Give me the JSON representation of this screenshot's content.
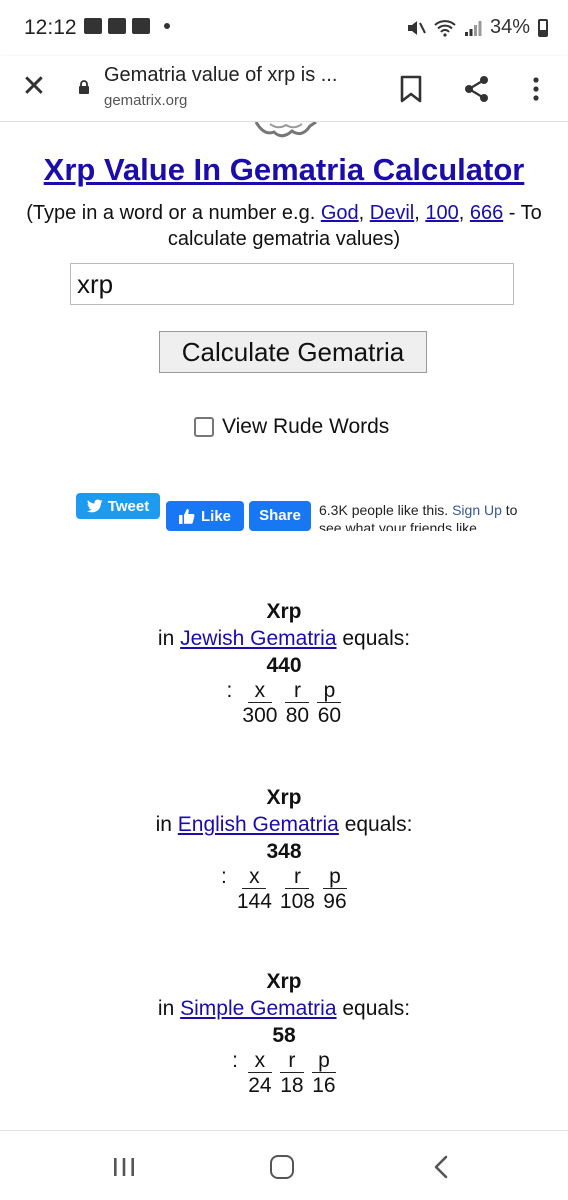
{
  "status": {
    "time": "12:12",
    "battery": "34%"
  },
  "browser": {
    "title": "Gematria value of xrp is ...",
    "domain": "gematrix.org"
  },
  "page": {
    "title": "Xrp Value In Gematria Calculator",
    "subtitle_prefix": "(Type in a word or a number e.g.",
    "examples": [
      "God",
      "Devil",
      "100",
      "666"
    ],
    "subtitle_suffix": "- To calculate gematria values)",
    "search_value": "xrp",
    "calculate_label": "Calculate Gematria",
    "rude_label": "View Rude Words",
    "tweet_label": "Tweet",
    "like_label": "Like",
    "share_label": "Share",
    "like_count_text": "6.3K people like this.",
    "sign_up_text": "Sign Up",
    "like_suffix": "to see what your friends like."
  },
  "results": [
    {
      "word": "Xrp",
      "prefix": "in",
      "system": "Jewish Gematria",
      "suffix": "equals:",
      "total": "440",
      "letters": [
        "x",
        "r",
        "p"
      ],
      "values": [
        "300",
        "80",
        "60"
      ]
    },
    {
      "word": "Xrp",
      "prefix": "in",
      "system": "English Gematria",
      "suffix": "equals:",
      "total": "348",
      "letters": [
        "x",
        "r",
        "p"
      ],
      "values": [
        "144",
        "108",
        "96"
      ]
    },
    {
      "word": "Xrp",
      "prefix": "in",
      "system": "Simple Gematria",
      "suffix": "equals:",
      "total": "58",
      "letters": [
        "x",
        "r",
        "p"
      ],
      "values": [
        "24",
        "18",
        "16"
      ]
    }
  ]
}
